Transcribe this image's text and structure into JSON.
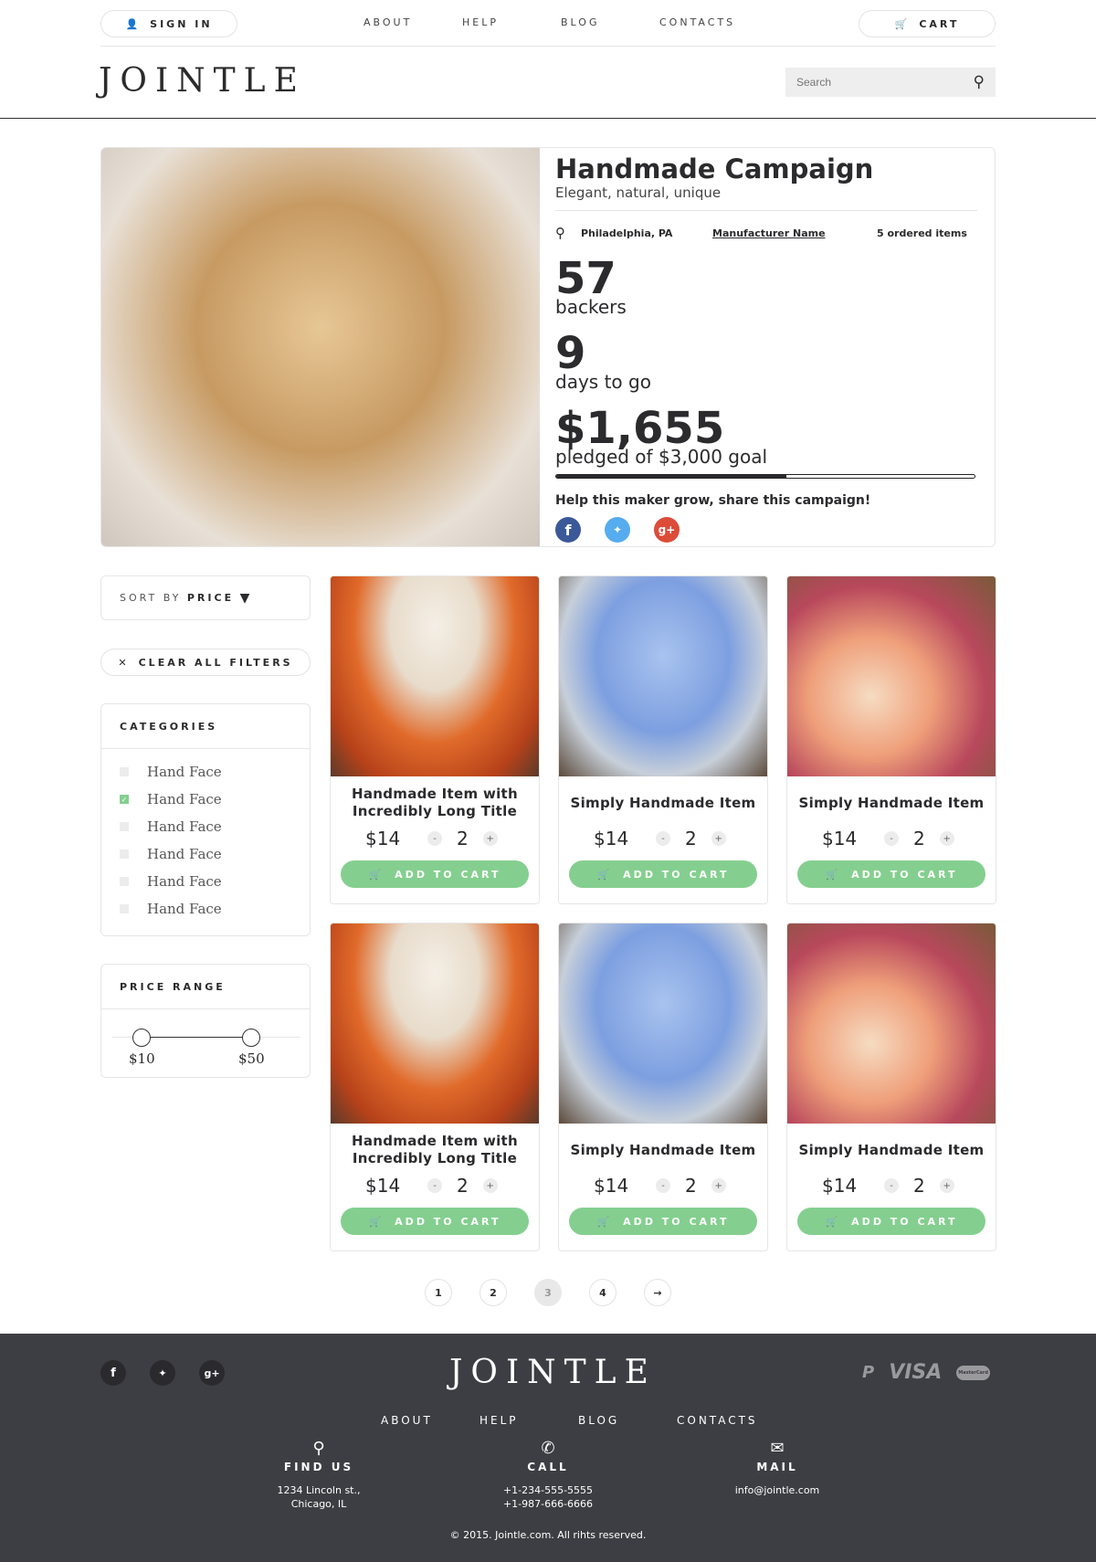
{
  "header": {
    "sign_in": "SIGN IN",
    "nav": [
      "ABOUT",
      "HELP",
      "BLOG",
      "CONTACTS"
    ],
    "cart": "CART",
    "logo": "JOINTLE",
    "search_placeholder": "Search"
  },
  "campaign": {
    "title": "Handmade Campaign",
    "subtitle": "Elegant, natural, unique",
    "location": "Philadelphia, PA",
    "manufacturer": "Manufacturer Name",
    "ordered": "5 ordered items",
    "backers": "57",
    "backers_label": "backers",
    "days": "9",
    "days_label": "days to go",
    "pledged": "$1,655",
    "pledged_label": "pledged of $3,000 goal",
    "progress_percent": 55,
    "share": "Help this maker grow, share this campaign!"
  },
  "sidebar": {
    "sort_label": "SORT BY",
    "sort_value": "PRICE",
    "clear": "CLEAR ALL FILTERS",
    "categories_title": "CATEGORIES",
    "categories": [
      {
        "label": "Hand Face",
        "checked": false
      },
      {
        "label": "Hand Face",
        "checked": true
      },
      {
        "label": "Hand Face",
        "checked": false
      },
      {
        "label": "Hand Face",
        "checked": false
      },
      {
        "label": "Hand Face",
        "checked": false
      },
      {
        "label": "Hand Face",
        "checked": false
      }
    ],
    "price_title": "PRICE RANGE",
    "price_min": "$10",
    "price_max": "$50"
  },
  "products": [
    {
      "title": "Handmade Item with Incredibly Long Title",
      "price": "$14",
      "qty": "2",
      "image": "jar"
    },
    {
      "title": "Simply Handmade Item",
      "price": "$14",
      "qty": "2",
      "image": "scrub"
    },
    {
      "title": "Simply Handmade Item",
      "price": "$14",
      "qty": "2",
      "image": "cupcake"
    },
    {
      "title": "Handmade Item with Incredibly Long Title",
      "price": "$14",
      "qty": "2",
      "image": "jar"
    },
    {
      "title": "Simply Handmade Item",
      "price": "$14",
      "qty": "2",
      "image": "scrub"
    },
    {
      "title": "Simply Handmade Item",
      "price": "$14",
      "qty": "2",
      "image": "cupcake"
    }
  ],
  "add_to_cart": "ADD TO CART",
  "qty_minus": "-",
  "qty_plus": "+",
  "pagination": {
    "pages": [
      "1",
      "2",
      "3",
      "4"
    ],
    "current": "3"
  },
  "footer": {
    "logo": "JOINTLE",
    "nav": [
      "ABOUT",
      "HELP",
      "BLOG",
      "CONTACTS"
    ],
    "find_us": "FIND US",
    "address1": "1234 Lincoln st.,",
    "address2": "Chicago, IL",
    "call": "CALL",
    "phone1": "+1-234-555-5555",
    "phone2": "+1-987-666-6666",
    "mail": "MAIL",
    "email": "info@jointle.com",
    "copyright": "© 2015. Jointle.com. All rihts reserved.",
    "payments": [
      "P",
      "VISA",
      "MasterCard"
    ]
  },
  "colors": {
    "accent": "#84cf8f",
    "footer": "#3d3e43",
    "facebook": "#3b5998",
    "twitter": "#55acee",
    "google": "#dd4b39"
  }
}
